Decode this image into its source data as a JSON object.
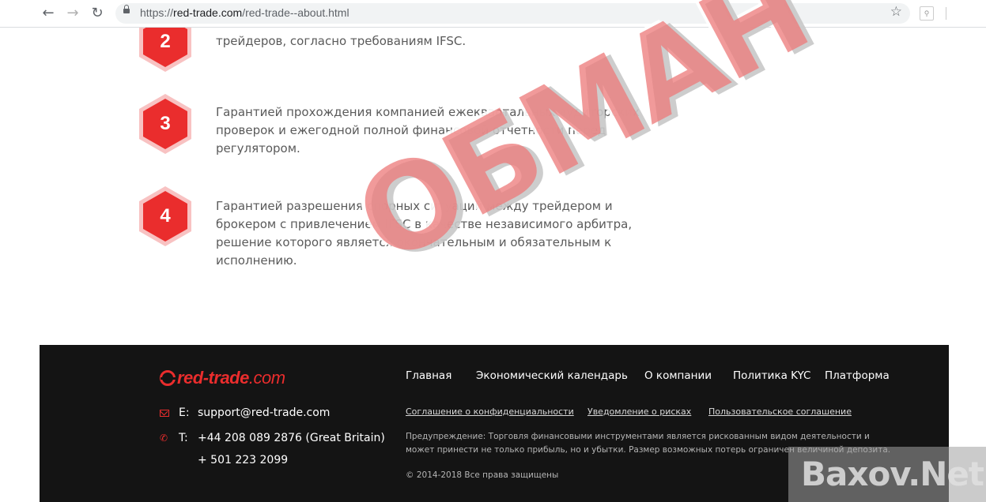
{
  "browser": {
    "url_prefix": "https://",
    "url_host": "red-trade.com",
    "url_path": "/red-trade--about.html",
    "back_icon": "←",
    "forward_icon": "→",
    "reload_icon": "↻",
    "star_icon": "☆"
  },
  "steps": [
    {
      "number": "2",
      "text": "трейдеров, согласно требованиям IFSC."
    },
    {
      "number": "3",
      "text": "Гарантией прохождения компанией ежеквартальных аудиторских проверок и ежегодной полной финансовой отчетности перед регулятором."
    },
    {
      "number": "4",
      "text": "Гарантией разрешения спорных ситуаций между трейдером и брокером с привлечением IFSC в качестве независимого арбитра, решение которого является окончательным и обязательным к исполнению."
    }
  ],
  "stamp": {
    "text": "ОБМАН"
  },
  "footer": {
    "logo_main": "red-trade",
    "logo_domain": ".com",
    "email_label": "E:",
    "email": "support@red-trade.com",
    "phone_label": "T:",
    "phone_1": "+44 208 089 2876  (Great Britain)",
    "phone_2": "+ 501 223 2099",
    "menu": [
      "Главная",
      "Экономический календарь",
      "О компании",
      "Политика KYC",
      "Платформа"
    ],
    "legal": [
      "Соглашение о конфиденциальности",
      "Уведомление о рисках",
      "Пользовательское соглашение"
    ],
    "warning": "Предупреждение: Торговля финансовыми инструментами является рискованным видом деятельности и может принести не только прибыль, но и убытки. Размер возможных потерь ограничен величиной депозита.",
    "copyright": "© 2014-2018 Все права защищены"
  },
  "watermark": {
    "text": "Baxov.Net"
  },
  "colors": {
    "accent": "#ea2d2d",
    "footer_bg": "#141414",
    "hex_glow": "#f7b5b5"
  }
}
